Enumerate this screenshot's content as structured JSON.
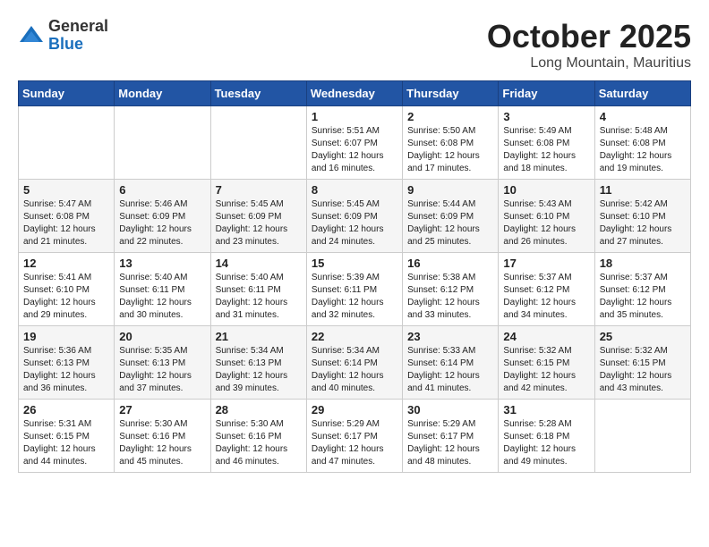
{
  "header": {
    "logo": {
      "general": "General",
      "blue": "Blue"
    },
    "title": "October 2025",
    "location": "Long Mountain, Mauritius"
  },
  "weekdays": [
    "Sunday",
    "Monday",
    "Tuesday",
    "Wednesday",
    "Thursday",
    "Friday",
    "Saturday"
  ],
  "weeks": [
    [
      {
        "day": "",
        "info": ""
      },
      {
        "day": "",
        "info": ""
      },
      {
        "day": "",
        "info": ""
      },
      {
        "day": "1",
        "info": "Sunrise: 5:51 AM\nSunset: 6:07 PM\nDaylight: 12 hours and 16 minutes."
      },
      {
        "day": "2",
        "info": "Sunrise: 5:50 AM\nSunset: 6:08 PM\nDaylight: 12 hours and 17 minutes."
      },
      {
        "day": "3",
        "info": "Sunrise: 5:49 AM\nSunset: 6:08 PM\nDaylight: 12 hours and 18 minutes."
      },
      {
        "day": "4",
        "info": "Sunrise: 5:48 AM\nSunset: 6:08 PM\nDaylight: 12 hours and 19 minutes."
      }
    ],
    [
      {
        "day": "5",
        "info": "Sunrise: 5:47 AM\nSunset: 6:08 PM\nDaylight: 12 hours and 21 minutes."
      },
      {
        "day": "6",
        "info": "Sunrise: 5:46 AM\nSunset: 6:09 PM\nDaylight: 12 hours and 22 minutes."
      },
      {
        "day": "7",
        "info": "Sunrise: 5:45 AM\nSunset: 6:09 PM\nDaylight: 12 hours and 23 minutes."
      },
      {
        "day": "8",
        "info": "Sunrise: 5:45 AM\nSunset: 6:09 PM\nDaylight: 12 hours and 24 minutes."
      },
      {
        "day": "9",
        "info": "Sunrise: 5:44 AM\nSunset: 6:09 PM\nDaylight: 12 hours and 25 minutes."
      },
      {
        "day": "10",
        "info": "Sunrise: 5:43 AM\nSunset: 6:10 PM\nDaylight: 12 hours and 26 minutes."
      },
      {
        "day": "11",
        "info": "Sunrise: 5:42 AM\nSunset: 6:10 PM\nDaylight: 12 hours and 27 minutes."
      }
    ],
    [
      {
        "day": "12",
        "info": "Sunrise: 5:41 AM\nSunset: 6:10 PM\nDaylight: 12 hours and 29 minutes."
      },
      {
        "day": "13",
        "info": "Sunrise: 5:40 AM\nSunset: 6:11 PM\nDaylight: 12 hours and 30 minutes."
      },
      {
        "day": "14",
        "info": "Sunrise: 5:40 AM\nSunset: 6:11 PM\nDaylight: 12 hours and 31 minutes."
      },
      {
        "day": "15",
        "info": "Sunrise: 5:39 AM\nSunset: 6:11 PM\nDaylight: 12 hours and 32 minutes."
      },
      {
        "day": "16",
        "info": "Sunrise: 5:38 AM\nSunset: 6:12 PM\nDaylight: 12 hours and 33 minutes."
      },
      {
        "day": "17",
        "info": "Sunrise: 5:37 AM\nSunset: 6:12 PM\nDaylight: 12 hours and 34 minutes."
      },
      {
        "day": "18",
        "info": "Sunrise: 5:37 AM\nSunset: 6:12 PM\nDaylight: 12 hours and 35 minutes."
      }
    ],
    [
      {
        "day": "19",
        "info": "Sunrise: 5:36 AM\nSunset: 6:13 PM\nDaylight: 12 hours and 36 minutes."
      },
      {
        "day": "20",
        "info": "Sunrise: 5:35 AM\nSunset: 6:13 PM\nDaylight: 12 hours and 37 minutes."
      },
      {
        "day": "21",
        "info": "Sunrise: 5:34 AM\nSunset: 6:13 PM\nDaylight: 12 hours and 39 minutes."
      },
      {
        "day": "22",
        "info": "Sunrise: 5:34 AM\nSunset: 6:14 PM\nDaylight: 12 hours and 40 minutes."
      },
      {
        "day": "23",
        "info": "Sunrise: 5:33 AM\nSunset: 6:14 PM\nDaylight: 12 hours and 41 minutes."
      },
      {
        "day": "24",
        "info": "Sunrise: 5:32 AM\nSunset: 6:15 PM\nDaylight: 12 hours and 42 minutes."
      },
      {
        "day": "25",
        "info": "Sunrise: 5:32 AM\nSunset: 6:15 PM\nDaylight: 12 hours and 43 minutes."
      }
    ],
    [
      {
        "day": "26",
        "info": "Sunrise: 5:31 AM\nSunset: 6:15 PM\nDaylight: 12 hours and 44 minutes."
      },
      {
        "day": "27",
        "info": "Sunrise: 5:30 AM\nSunset: 6:16 PM\nDaylight: 12 hours and 45 minutes."
      },
      {
        "day": "28",
        "info": "Sunrise: 5:30 AM\nSunset: 6:16 PM\nDaylight: 12 hours and 46 minutes."
      },
      {
        "day": "29",
        "info": "Sunrise: 5:29 AM\nSunset: 6:17 PM\nDaylight: 12 hours and 47 minutes."
      },
      {
        "day": "30",
        "info": "Sunrise: 5:29 AM\nSunset: 6:17 PM\nDaylight: 12 hours and 48 minutes."
      },
      {
        "day": "31",
        "info": "Sunrise: 5:28 AM\nSunset: 6:18 PM\nDaylight: 12 hours and 49 minutes."
      },
      {
        "day": "",
        "info": ""
      }
    ]
  ]
}
